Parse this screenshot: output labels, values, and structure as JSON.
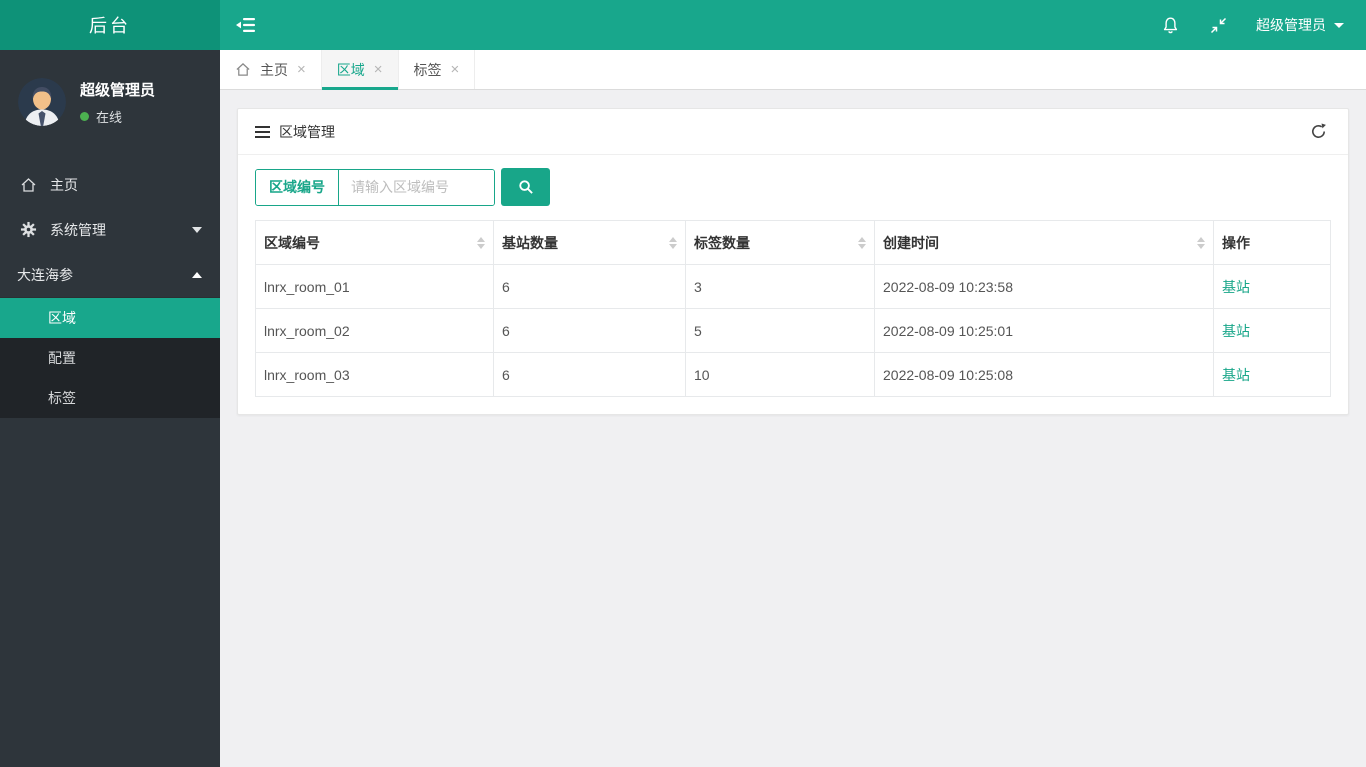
{
  "app": {
    "title": "后台"
  },
  "navbar": {
    "user_label": "超级管理员"
  },
  "ui": {
    "close_glyph": "×"
  },
  "sidebar": {
    "user": {
      "name": "超级管理员",
      "status": "在线"
    },
    "menu": [
      {
        "label": "主页",
        "icon": "home-icon"
      },
      {
        "label": "系统管理",
        "icon": "gear-icon",
        "state": "collapsed"
      },
      {
        "label": "大连海参",
        "icon": null,
        "state": "expanded",
        "children": [
          {
            "label": "区域",
            "active": true
          },
          {
            "label": "配置",
            "active": false
          },
          {
            "label": "标签",
            "active": false
          }
        ]
      }
    ]
  },
  "tabs": [
    {
      "label": "主页",
      "icon": "home-icon",
      "active": false
    },
    {
      "label": "区域",
      "icon": null,
      "active": true
    },
    {
      "label": "标签",
      "icon": null,
      "active": false
    }
  ],
  "main": {
    "card_title": "区域管理",
    "search": {
      "field_label": "区域编号",
      "placeholder": "请输入区域编号"
    },
    "table": {
      "columns": [
        {
          "label": "区域编号",
          "sortable": true
        },
        {
          "label": "基站数量",
          "sortable": true
        },
        {
          "label": "标签数量",
          "sortable": true
        },
        {
          "label": "创建时间",
          "sortable": true
        },
        {
          "label": "操作",
          "sortable": false
        }
      ],
      "rows": [
        {
          "area_id": "lnrx_room_01",
          "base_station_count": "6",
          "tag_count": "3",
          "created_at": "2022-08-09 10:23:58",
          "action_label": "基站"
        },
        {
          "area_id": "lnrx_room_02",
          "base_station_count": "6",
          "tag_count": "5",
          "created_at": "2022-08-09 10:25:01",
          "action_label": "基站"
        },
        {
          "area_id": "lnrx_room_03",
          "base_station_count": "6",
          "tag_count": "10",
          "created_at": "2022-08-09 10:25:08",
          "action_label": "基站"
        }
      ]
    }
  },
  "colors": {
    "teal": "#18A78C",
    "teal_dark": "#0E9278",
    "sidebar_bg": "#2E353B",
    "submenu_bg": "#202428",
    "online_green": "#4CB050",
    "link": "#18A689"
  }
}
